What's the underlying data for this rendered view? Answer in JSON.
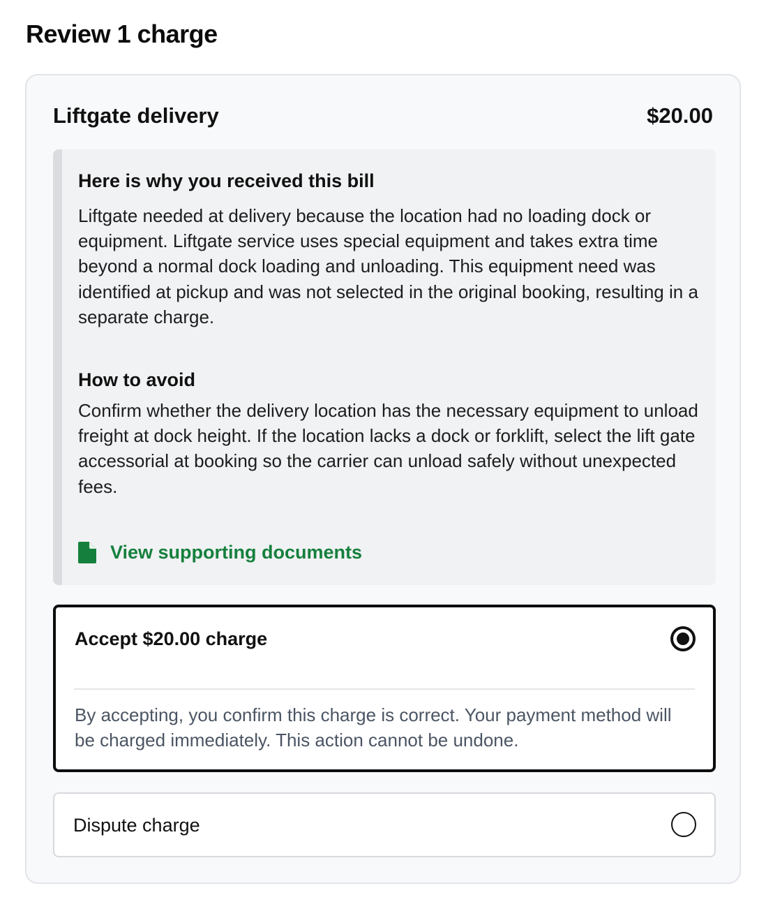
{
  "page": {
    "title": "Review 1 charge"
  },
  "charge": {
    "name": "Liftgate delivery",
    "amount": "$20.00"
  },
  "reason": {
    "heading": "Here is why you received this bill",
    "body": "Liftgate needed at delivery because the location had no loading dock or equipment. Liftgate service uses special equipment and takes extra time beyond a normal dock loading and unloading. This equipment need was identified at pickup and was not selected in the original booking, resulting in a separate charge.",
    "avoid_heading": "How to avoid",
    "avoid_body": "Confirm whether the delivery location has the necessary equipment to unload freight at dock height. If the location lacks a dock or forklift, select the lift gate accessorial at booking so the carrier can unload safely without unexpected fees.",
    "docs_link": "View supporting documents",
    "docs_icon": "document-icon"
  },
  "options": {
    "accept": {
      "label": "Accept $20.00 charge",
      "selected": true,
      "note": "By accepting, you confirm this charge is correct. Your payment method will be charged immediately. This action cannot be undone."
    },
    "dispute": {
      "label": "Dispute charge",
      "selected": false
    }
  },
  "colors": {
    "link_green": "#15803d",
    "card_background": "#f8f9fa",
    "reason_background": "#f1f2f4",
    "selected_border": "#0d0d0d"
  }
}
